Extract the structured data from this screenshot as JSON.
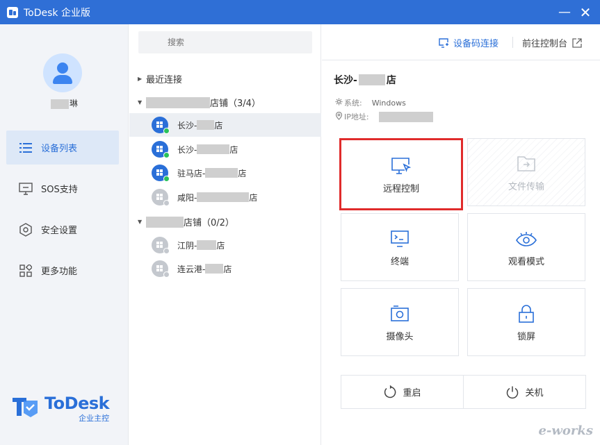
{
  "window": {
    "title": "ToDesk 企业版",
    "minimize": "—",
    "close": "✕"
  },
  "sidebar": {
    "username_suffix": "琳",
    "nav": [
      {
        "label": "设备列表",
        "icon": "list-icon",
        "active": true
      },
      {
        "label": "SOS支持",
        "icon": "sos-icon",
        "active": false
      },
      {
        "label": "安全设置",
        "icon": "shield-hex-icon",
        "active": false
      },
      {
        "label": "更多功能",
        "icon": "grid-icon",
        "active": false
      }
    ],
    "brand": {
      "name": "ToDesk",
      "sub": "企业主控"
    }
  },
  "device_list": {
    "search_placeholder": "搜索",
    "recent_label": "最近连接",
    "groups": [
      {
        "suffix": "店铺（3/4）",
        "devices": [
          {
            "prefix": "长沙-",
            "suffix": "店",
            "online": true,
            "selected": true
          },
          {
            "prefix": "长沙-",
            "suffix": "店",
            "online": true,
            "selected": false
          },
          {
            "prefix": "驻马店-",
            "suffix": "店",
            "online": true,
            "selected": false
          },
          {
            "prefix": "咸阳-",
            "suffix": "店",
            "online": false,
            "selected": false
          }
        ]
      },
      {
        "suffix": "店铺（0/2）",
        "devices": [
          {
            "prefix": "江阴-",
            "suffix": "店",
            "online": false,
            "selected": false
          },
          {
            "prefix": "连云港-",
            "suffix": "店",
            "online": false,
            "selected": false
          }
        ]
      }
    ]
  },
  "detail": {
    "code_connect": "设备码连接",
    "goto_console": "前往控制台",
    "title_prefix": "长沙-",
    "title_suffix": "店",
    "system_label": "系统:",
    "system_value": "Windows",
    "ip_label": "IP地址:",
    "actions": [
      {
        "label": "远程控制",
        "icon": "remote-control-icon",
        "enabled": true,
        "highlighted": true
      },
      {
        "label": "文件传输",
        "icon": "folder-transfer-icon",
        "enabled": false,
        "highlighted": false
      },
      {
        "label": "终端",
        "icon": "terminal-icon",
        "enabled": true,
        "highlighted": false
      },
      {
        "label": "观看模式",
        "icon": "eye-icon",
        "enabled": true,
        "highlighted": false
      },
      {
        "label": "摄像头",
        "icon": "camera-icon",
        "enabled": true,
        "highlighted": false
      },
      {
        "label": "锁屏",
        "icon": "lock-icon",
        "enabled": true,
        "highlighted": false
      }
    ],
    "restart": "重启",
    "shutdown": "关机"
  },
  "watermark": "e-works",
  "colors": {
    "titlebar": "#2f6fd6",
    "accent": "#2a6fd8",
    "highlight_border": "#e02b2b",
    "online": "#2ac15a"
  }
}
